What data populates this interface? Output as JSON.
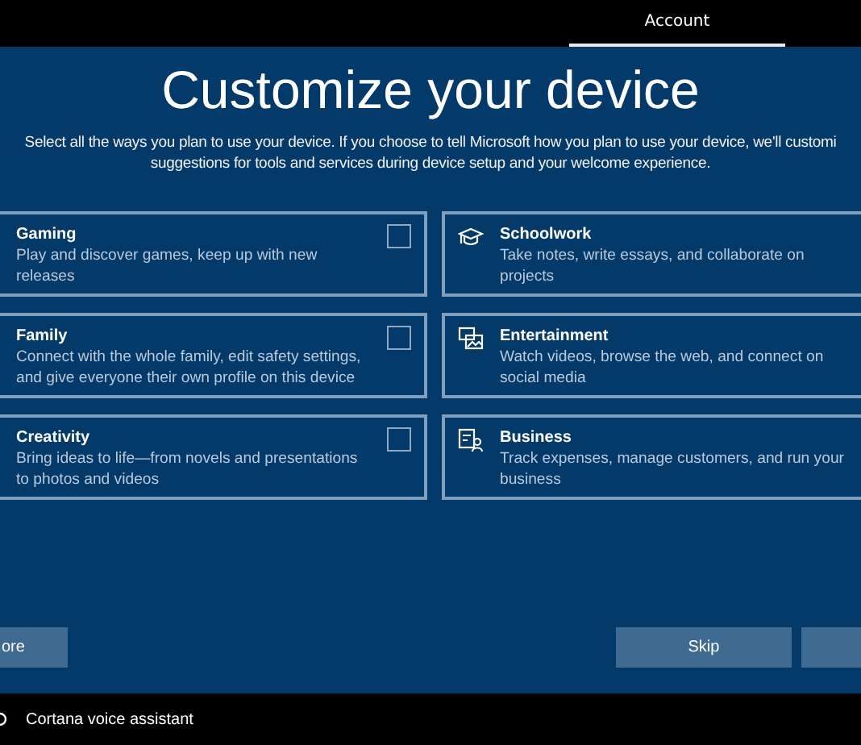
{
  "top_tabs": [
    {
      "label": "Account",
      "selected": true
    }
  ],
  "title": "Customize your device",
  "description_lines": [
    "Select all the ways you plan to use your device. If you choose to tell Microsoft how you plan to use your device, we'll customi",
    "suggestions for tools and services during device setup and your welcome experience."
  ],
  "left_cards": [
    {
      "title": "Gaming",
      "text": "Play and discover games, keep up with new releases",
      "checked": false
    },
    {
      "title": "Family",
      "text": "Connect with the whole family, edit safety settings, and give everyone their own profile on this device",
      "checked": false
    },
    {
      "title": "Creativity",
      "text": "Bring ideas to life—from novels and presentations to photos and videos",
      "checked": false
    }
  ],
  "right_cards": [
    {
      "title": "Schoolwork",
      "text": "Take notes, write essays, and collaborate on projects",
      "kind": "cap"
    },
    {
      "title": "Entertainment",
      "text": "Watch videos, browse the web, and connect on social media",
      "kind": "media"
    },
    {
      "title": "Business",
      "text": "Track expenses, manage customers, and run your business",
      "kind": "badge"
    }
  ],
  "buttons": {
    "left": "ore",
    "right": [
      "Skip"
    ]
  },
  "footer": {
    "label": "Cortana voice assistant"
  }
}
